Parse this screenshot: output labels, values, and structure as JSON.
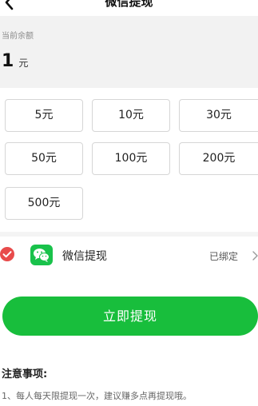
{
  "header": {
    "title": "微信提现",
    "back_icon": "chevron-left-icon"
  },
  "balance": {
    "label": "当前余额",
    "amount": "1",
    "unit": "元"
  },
  "amounts": [
    "5元",
    "10元",
    "30元",
    "50元",
    "100元",
    "200元",
    "500元"
  ],
  "payment": {
    "method_label": "微信提现",
    "status": "已绑定",
    "check_icon": "checkmark-circle-icon",
    "wechat_icon": "wechat-icon",
    "arrow_icon": "chevron-right-icon"
  },
  "submit": {
    "label": "立即提现"
  },
  "notes": {
    "title": "注意事项:",
    "items": [
      "1、每人每天限提现一次，建议赚多点再提现哦。"
    ]
  },
  "colors": {
    "accent": "#18be3c",
    "check": "#e84b4b",
    "balance_bg": "#f2f2f2"
  }
}
